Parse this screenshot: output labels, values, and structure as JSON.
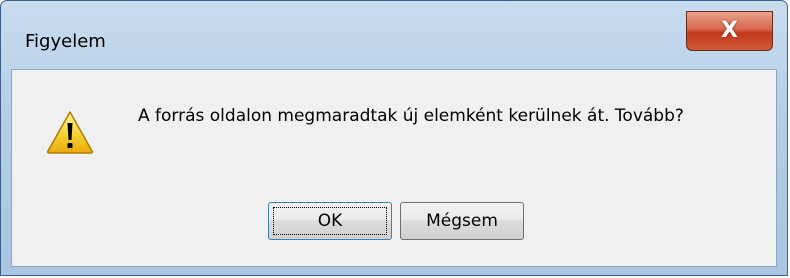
{
  "window": {
    "title": "Figyelem",
    "close_glyph": "X"
  },
  "dialog": {
    "icon": "warning-icon",
    "message": "A forrás oldalon megmaradtak új elemként kerülnek át. Tovább?"
  },
  "buttons": {
    "ok_label": "OK",
    "cancel_label": "Mégsem"
  },
  "colors": {
    "close_button": "#c2381b",
    "title_frame": "#b3cde6",
    "client_background": "#f0f0f0",
    "warning_yellow": "#f7c817"
  }
}
